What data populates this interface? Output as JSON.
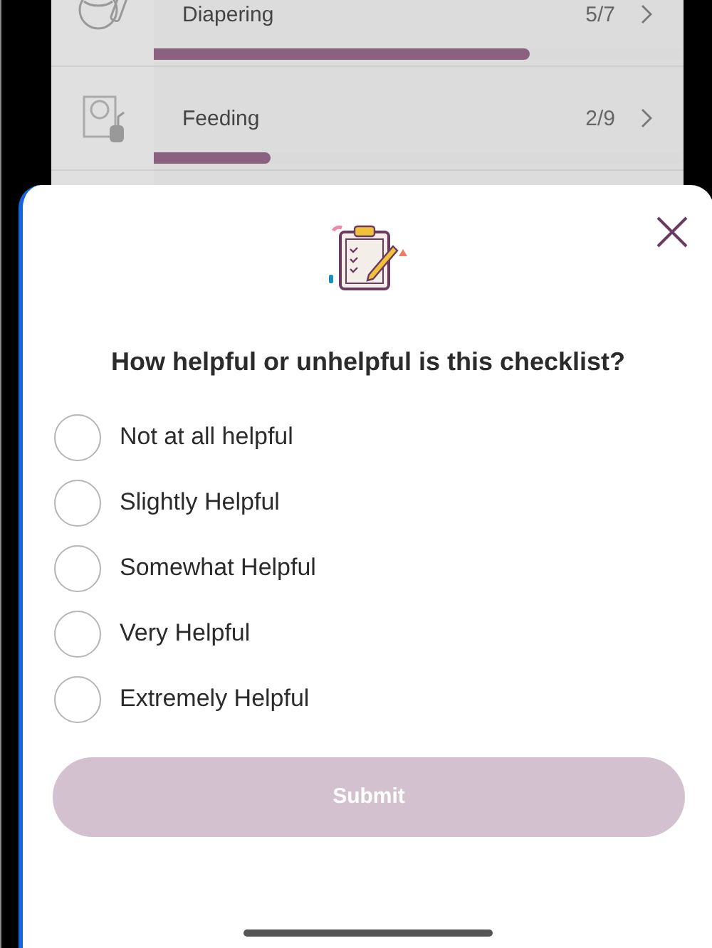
{
  "checklist": [
    {
      "title": "Diapering",
      "count": "5/7",
      "level": 0.714,
      "kind": "diaper"
    },
    {
      "title": "Feeding",
      "count": "2/9",
      "level": 0.222,
      "kind": "bib"
    }
  ],
  "survey": {
    "question": "How helpful or unhelpful is this checklist?",
    "options": [
      {
        "label": "Not at all helpful",
        "selected": false
      },
      {
        "label": "Slightly Helpful",
        "selected": false
      },
      {
        "label": "Somewhat Helpful",
        "selected": false
      },
      {
        "label": "Very Helpful",
        "selected": false
      },
      {
        "label": "Extremely Helpful",
        "selected": false
      }
    ],
    "submit": {
      "label": "Submit",
      "disabled": true
    }
  }
}
